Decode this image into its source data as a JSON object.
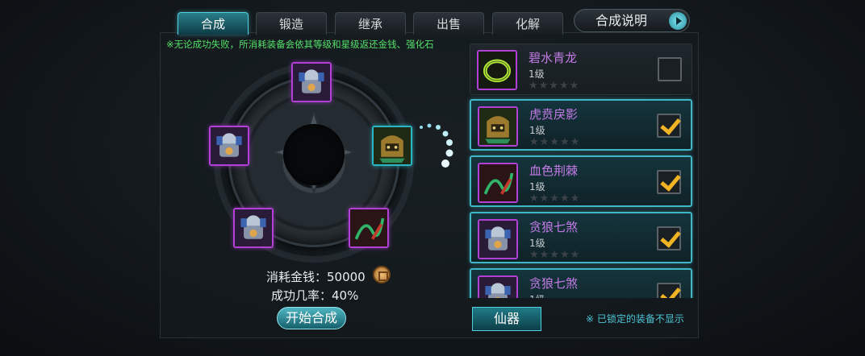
{
  "tabs": [
    {
      "label": "合成",
      "active": true
    },
    {
      "label": "锻造",
      "active": false
    },
    {
      "label": "继承",
      "active": false
    },
    {
      "label": "出售",
      "active": false
    },
    {
      "label": "化解",
      "active": false
    }
  ],
  "help_button": {
    "label": "合成说明"
  },
  "notice": "※无论成功失败，所消耗装备会依其等级和星级返还金钱、强化石",
  "synthesis": {
    "slots": [
      {
        "item": "贪狼七煞",
        "icon": "armor-icon"
      },
      {
        "item": "贪狼七煞",
        "icon": "armor-icon"
      },
      {
        "item": "虎贲戾影",
        "icon": "helmet-icon"
      },
      {
        "item": "贪狼七煞",
        "icon": "armor-icon"
      },
      {
        "item": "血色荆棘",
        "icon": "whip-icon"
      }
    ],
    "cost_text": "消耗金钱：50000",
    "rate_text": "成功几率：40%",
    "start_button": "开始合成"
  },
  "equipment_list": [
    {
      "name": "碧水青龙",
      "level": "1级",
      "stars": "★★★★★",
      "checked": false,
      "selected": false,
      "icon": "ring-icon"
    },
    {
      "name": "虎贲戾影",
      "level": "1级",
      "stars": "★★★★★",
      "checked": true,
      "selected": true,
      "icon": "helmet-icon"
    },
    {
      "name": "血色荆棘",
      "level": "1级",
      "stars": "★★★★★",
      "checked": true,
      "selected": true,
      "icon": "whip-icon"
    },
    {
      "name": "贪狼七煞",
      "level": "1级",
      "stars": "★★★★★",
      "checked": true,
      "selected": true,
      "icon": "armor-icon"
    },
    {
      "name": "贪狼七煞",
      "level": "1级",
      "stars": "★★★★★",
      "checked": true,
      "selected": true,
      "icon": "armor-icon"
    }
  ],
  "category_tab": "仙器",
  "lock_note": "※ 已锁定的装备不显示",
  "colors": {
    "accent": "#3fb7c6",
    "rarity_purple": "#b23fd6",
    "check_gold": "#f0b323",
    "notice_green": "#53e06a"
  }
}
